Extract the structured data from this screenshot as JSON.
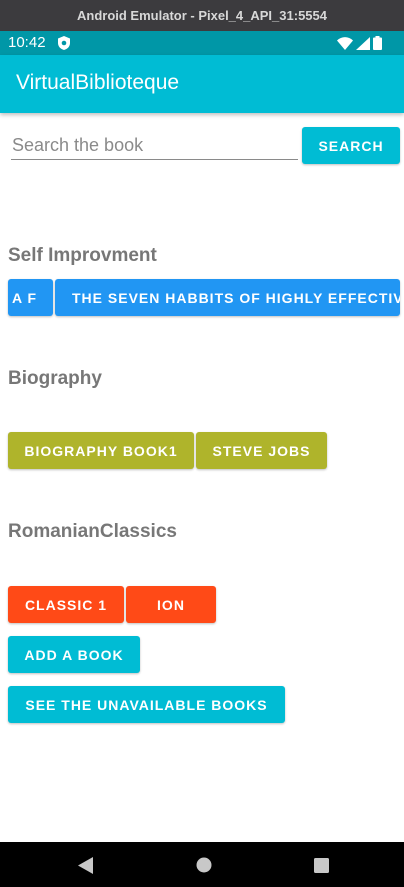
{
  "window": {
    "title": "Android Emulator - Pixel_4_API_31:5554"
  },
  "status_bar": {
    "time": "10:42"
  },
  "app_bar": {
    "title": "VirtualBiblioteque"
  },
  "search": {
    "placeholder": "Search the book",
    "value": "",
    "button_label": "SEARCH"
  },
  "categories": [
    {
      "name": "Self Improvment",
      "books": [
        "A F",
        "THE SEVEN HABBITS OF HIGHLY EFFECTIV"
      ]
    },
    {
      "name": "Biography",
      "books": [
        "BIOGRAPHY BOOK1",
        "STEVE JOBS"
      ]
    },
    {
      "name": "RomanianClassics",
      "books": [
        "CLASSIC 1",
        "ION"
      ]
    }
  ],
  "actions": {
    "add_book": "ADD A BOOK",
    "see_unavailable": "SEE THE UNAVAILABLE BOOKS"
  },
  "colors": {
    "primary": "#00bcd4",
    "primary_dark": "#0097a7",
    "self_improvement": "#2196f3",
    "biography": "#afb42b",
    "romanian_classics": "#ff4a17"
  }
}
